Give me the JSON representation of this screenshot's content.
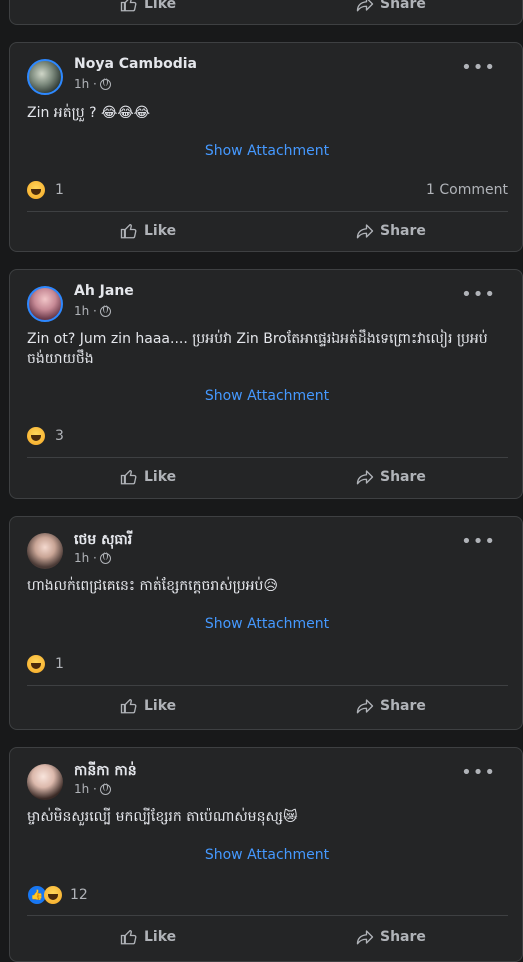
{
  "actions": {
    "like": "Like",
    "share": "Share"
  },
  "posts": [
    {
      "name": "Noya Cambodia",
      "time": "1h ·",
      "text": "Zin អត់ប្រួ ? 😂😂😂",
      "attachment": "Show Attachment",
      "reactions": "1",
      "comments": "1 Comment"
    },
    {
      "name": "Ah Jane",
      "time": "1h ·",
      "text": "Zin ot? Jum zin haaa.... ប្រអប់វា Zin Broតែអាផ្ទេរឯអត់ដឹងទេព្រោះវាលៀរ ប្រអប់ ចង់យាយថឹង",
      "attachment": "Show Attachment",
      "reactions": "3"
    },
    {
      "name": "ថេម សុធារី",
      "time": "1h ·",
      "text": "ហាងលក់ពេជ្រគេនេះ កាត់ខ្សែកក្ដេចរាស់ប្រអប់😥",
      "attachment": "Show Attachment",
      "reactions": "1"
    },
    {
      "name": "កានីកា កាន់",
      "time": "1h ·",
      "text": "ម្ចាស់មិនសួរល្បើ មកល្បីខ្សែរក តាប៉េណាស់មនុស្ស😿",
      "attachment": "Show Attachment",
      "reactions": "12"
    }
  ],
  "colors": {
    "background": "#18191a",
    "card": "#242526",
    "accent": "#4599ff",
    "muted": "#b0b3b8"
  }
}
